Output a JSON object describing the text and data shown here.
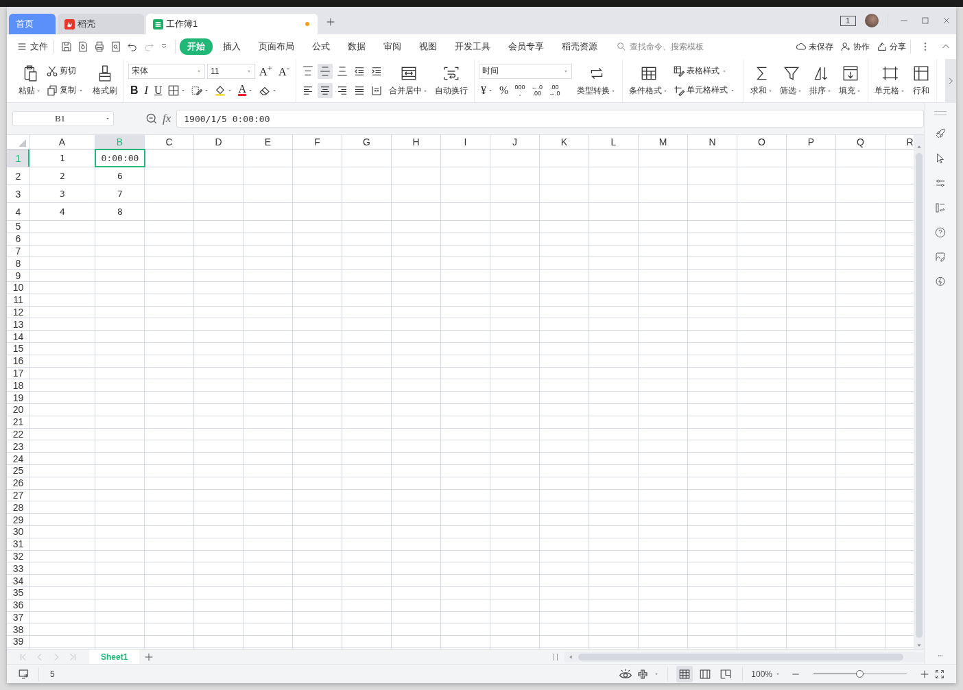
{
  "window": {
    "tabs": [
      {
        "label": "首页",
        "kind": "home",
        "selected": false
      },
      {
        "label": "稻壳",
        "kind": "docer",
        "selected": false
      },
      {
        "label": "工作簿1",
        "kind": "sheet",
        "selected": true,
        "unsaved": true
      }
    ],
    "window_count": "1"
  },
  "menu": {
    "file": "文件",
    "tabs": [
      {
        "label": "开始",
        "selected": true
      },
      {
        "label": "插入",
        "selected": false
      },
      {
        "label": "页面布局",
        "selected": false
      },
      {
        "label": "公式",
        "selected": false
      },
      {
        "label": "数据",
        "selected": false
      },
      {
        "label": "审阅",
        "selected": false
      },
      {
        "label": "视图",
        "selected": false
      },
      {
        "label": "开发工具",
        "selected": false
      },
      {
        "label": "会员专享",
        "selected": false
      },
      {
        "label": "稻壳资源",
        "selected": false
      }
    ],
    "search": {
      "placeholder": "查找命令、搜索模板"
    },
    "actions": [
      {
        "label": "未保存"
      },
      {
        "label": "协作"
      },
      {
        "label": "分享"
      }
    ]
  },
  "ribbon": [
    {
      "items": [
        {
          "kind": "large",
          "label": "粘贴",
          "dropdown": true
        },
        {
          "kind": "stack",
          "top": [
            {
              "kind": "small",
              "label": "剪切",
              "dropdown": false
            }
          ],
          "bottom": [
            {
              "kind": "small",
              "label": "复制",
              "dropdown": true
            }
          ]
        },
        {
          "kind": "large",
          "label": "格式刷",
          "dropdown": false
        }
      ]
    },
    {
      "items": [
        {
          "kind": "stack",
          "top": [
            {
              "kind": "select",
              "value": "宋体"
            },
            {
              "kind": "select",
              "value": "11"
            },
            {
              "kind": "glyph",
              "text": "A$^{+}$",
              "dropdown": false
            },
            {
              "kind": "glyph",
              "text": "A$^{-}$",
              "dropdown": false
            }
          ],
          "bottom": [
            {
              "kind": "glyph",
              "text": "B",
              "bold": true,
              "dropdown": false
            },
            {
              "kind": "glyph",
              "text": "I",
              "italic": true,
              "dropdown": false
            },
            {
              "kind": "glyph",
              "text": "U",
              "underline": true,
              "dropdown": false
            },
            {
              "kind": "icon",
              "dropdown": true
            },
            {
              "kind": "icon",
              "dropdown": true
            },
            {
              "kind": "icon",
              "dropdown": true
            },
            {
              "kind": "glyph",
              "text": "A",
              "font_color": true,
              "dropdown": true
            },
            {
              "kind": "icon",
              "dropdown": true
            }
          ]
        }
      ]
    },
    {
      "items": [
        {
          "kind": "stack",
          "top": [
            {
              "kind": "icon",
              "selected": false
            },
            {
              "kind": "icon",
              "selected": true
            },
            {
              "kind": "icon",
              "selected": false
            },
            {
              "kind": "icon",
              "selected": false
            },
            {
              "kind": "icon",
              "selected": false
            }
          ],
          "bottom": [
            {
              "kind": "icon",
              "selected": false
            },
            {
              "kind": "icon",
              "selected": true
            },
            {
              "kind": "icon",
              "selected": false
            },
            {
              "kind": "icon",
              "selected": false
            },
            {
              "kind": "icon",
              "selected": false
            }
          ]
        },
        {
          "kind": "large",
          "label": "合并居中",
          "dropdown": true
        },
        {
          "kind": "large",
          "label": "自动换行",
          "dropdown": false
        }
      ]
    },
    {
      "items": [
        {
          "kind": "stack",
          "top": [
            {
              "kind": "select",
              "value": "时间"
            }
          ],
          "bottom": [
            {
              "kind": "glyph",
              "text": "¥",
              "dropdown": true
            },
            {
              "kind": "glyph",
              "text": "%",
              "dropdown": false
            },
            {
              "kind": "glyph",
              "lines": [
                "000",
                ","
              ],
              "dropdown": false
            },
            {
              "kind": "glyph",
              "lines": [
                "←.0",
                ".00"
              ],
              "dropdown": false
            },
            {
              "kind": "glyph",
              "lines": [
                ".00",
                "→.0"
              ],
              "dropdown": false
            }
          ]
        },
        {
          "kind": "large",
          "label": "类型转换",
          "dropdown": true
        }
      ]
    },
    {
      "items": [
        {
          "kind": "large",
          "label": "条件格式",
          "dropdown": true
        },
        {
          "kind": "stack",
          "top": [
            {
              "kind": "small",
              "label": "表格样式",
              "dropdown": true
            }
          ],
          "bottom": [
            {
              "kind": "small",
              "label": "单元格样式",
              "dropdown": true
            }
          ]
        }
      ]
    },
    {
      "items": [
        {
          "kind": "large",
          "label": "求和",
          "dropdown": true
        },
        {
          "kind": "large",
          "label": "筛选",
          "dropdown": true
        },
        {
          "kind": "large",
          "label": "排序",
          "dropdown": true
        },
        {
          "kind": "large",
          "label": "填充",
          "dropdown": true
        }
      ]
    },
    {
      "items": [
        {
          "kind": "large",
          "label": "单元格",
          "dropdown": true
        },
        {
          "kind": "large",
          "label": "行和",
          "dropdown": false
        }
      ]
    }
  ],
  "formula_bar": {
    "name_box": "B1",
    "fx": "fx",
    "value": "1900/1/5 0:00:00"
  },
  "sheet": {
    "columns": [
      {
        "label": "A",
        "selected": false
      },
      {
        "label": "B",
        "selected": true
      },
      {
        "label": "C",
        "selected": false
      },
      {
        "label": "D",
        "selected": false
      },
      {
        "label": "E",
        "selected": false
      },
      {
        "label": "F",
        "selected": false
      },
      {
        "label": "G",
        "selected": false
      },
      {
        "label": "H",
        "selected": false
      },
      {
        "label": "I",
        "selected": false
      },
      {
        "label": "J",
        "selected": false
      },
      {
        "label": "K",
        "selected": false
      },
      {
        "label": "L",
        "selected": false
      },
      {
        "label": "M",
        "selected": false
      },
      {
        "label": "N",
        "selected": false
      },
      {
        "label": "O",
        "selected": false
      },
      {
        "label": "P",
        "selected": false
      },
      {
        "label": "Q",
        "selected": false
      },
      {
        "label": "R",
        "selected": false
      }
    ],
    "rows": [
      {
        "header": "1",
        "selected": true,
        "cells": [
          {
            "text": "1",
            "selected": false
          },
          {
            "text": "0:00:00",
            "selected": true
          }
        ]
      },
      {
        "header": "2",
        "selected": false,
        "cells": [
          {
            "text": "2",
            "selected": false
          },
          {
            "text": "6",
            "selected": false
          }
        ]
      },
      {
        "header": "3",
        "selected": false,
        "cells": [
          {
            "text": "3",
            "selected": false
          },
          {
            "text": "7",
            "selected": false
          }
        ]
      },
      {
        "header": "4",
        "selected": false,
        "cells": [
          {
            "text": "4",
            "selected": false
          },
          {
            "text": "8",
            "selected": false
          }
        ]
      },
      {
        "header": "5",
        "selected": false
      },
      {
        "header": "6",
        "selected": false
      },
      {
        "header": "7",
        "selected": false
      },
      {
        "header": "8",
        "selected": false
      },
      {
        "header": "9",
        "selected": false
      },
      {
        "header": "10",
        "selected": false
      },
      {
        "header": "11",
        "selected": false
      },
      {
        "header": "12",
        "selected": false
      },
      {
        "header": "13",
        "selected": false
      },
      {
        "header": "14",
        "selected": false
      },
      {
        "header": "15",
        "selected": false
      },
      {
        "header": "16",
        "selected": false
      },
      {
        "header": "17",
        "selected": false
      },
      {
        "header": "18",
        "selected": false
      },
      {
        "header": "19",
        "selected": false
      },
      {
        "header": "20",
        "selected": false
      },
      {
        "header": "21",
        "selected": false
      },
      {
        "header": "22",
        "selected": false
      },
      {
        "header": "23",
        "selected": false
      },
      {
        "header": "24",
        "selected": false
      },
      {
        "header": "25",
        "selected": false
      },
      {
        "header": "26",
        "selected": false
      },
      {
        "header": "27",
        "selected": false
      },
      {
        "header": "28",
        "selected": false
      },
      {
        "header": "29",
        "selected": false
      },
      {
        "header": "30",
        "selected": false
      },
      {
        "header": "31",
        "selected": false
      },
      {
        "header": "32",
        "selected": false
      },
      {
        "header": "33",
        "selected": false
      },
      {
        "header": "34",
        "selected": false
      },
      {
        "header": "35",
        "selected": false
      },
      {
        "header": "36",
        "selected": false
      },
      {
        "header": "37",
        "selected": false
      },
      {
        "header": "38",
        "selected": false
      },
      {
        "header": "39",
        "selected": false
      }
    ]
  },
  "sheet_tabs": [
    {
      "label": "Sheet1",
      "selected": true
    }
  ],
  "status_bar": {
    "count": "5",
    "views": [
      {
        "selected": true
      },
      {
        "selected": false
      },
      {
        "selected": false
      }
    ],
    "zoom": "100%",
    "level": 0.5
  }
}
